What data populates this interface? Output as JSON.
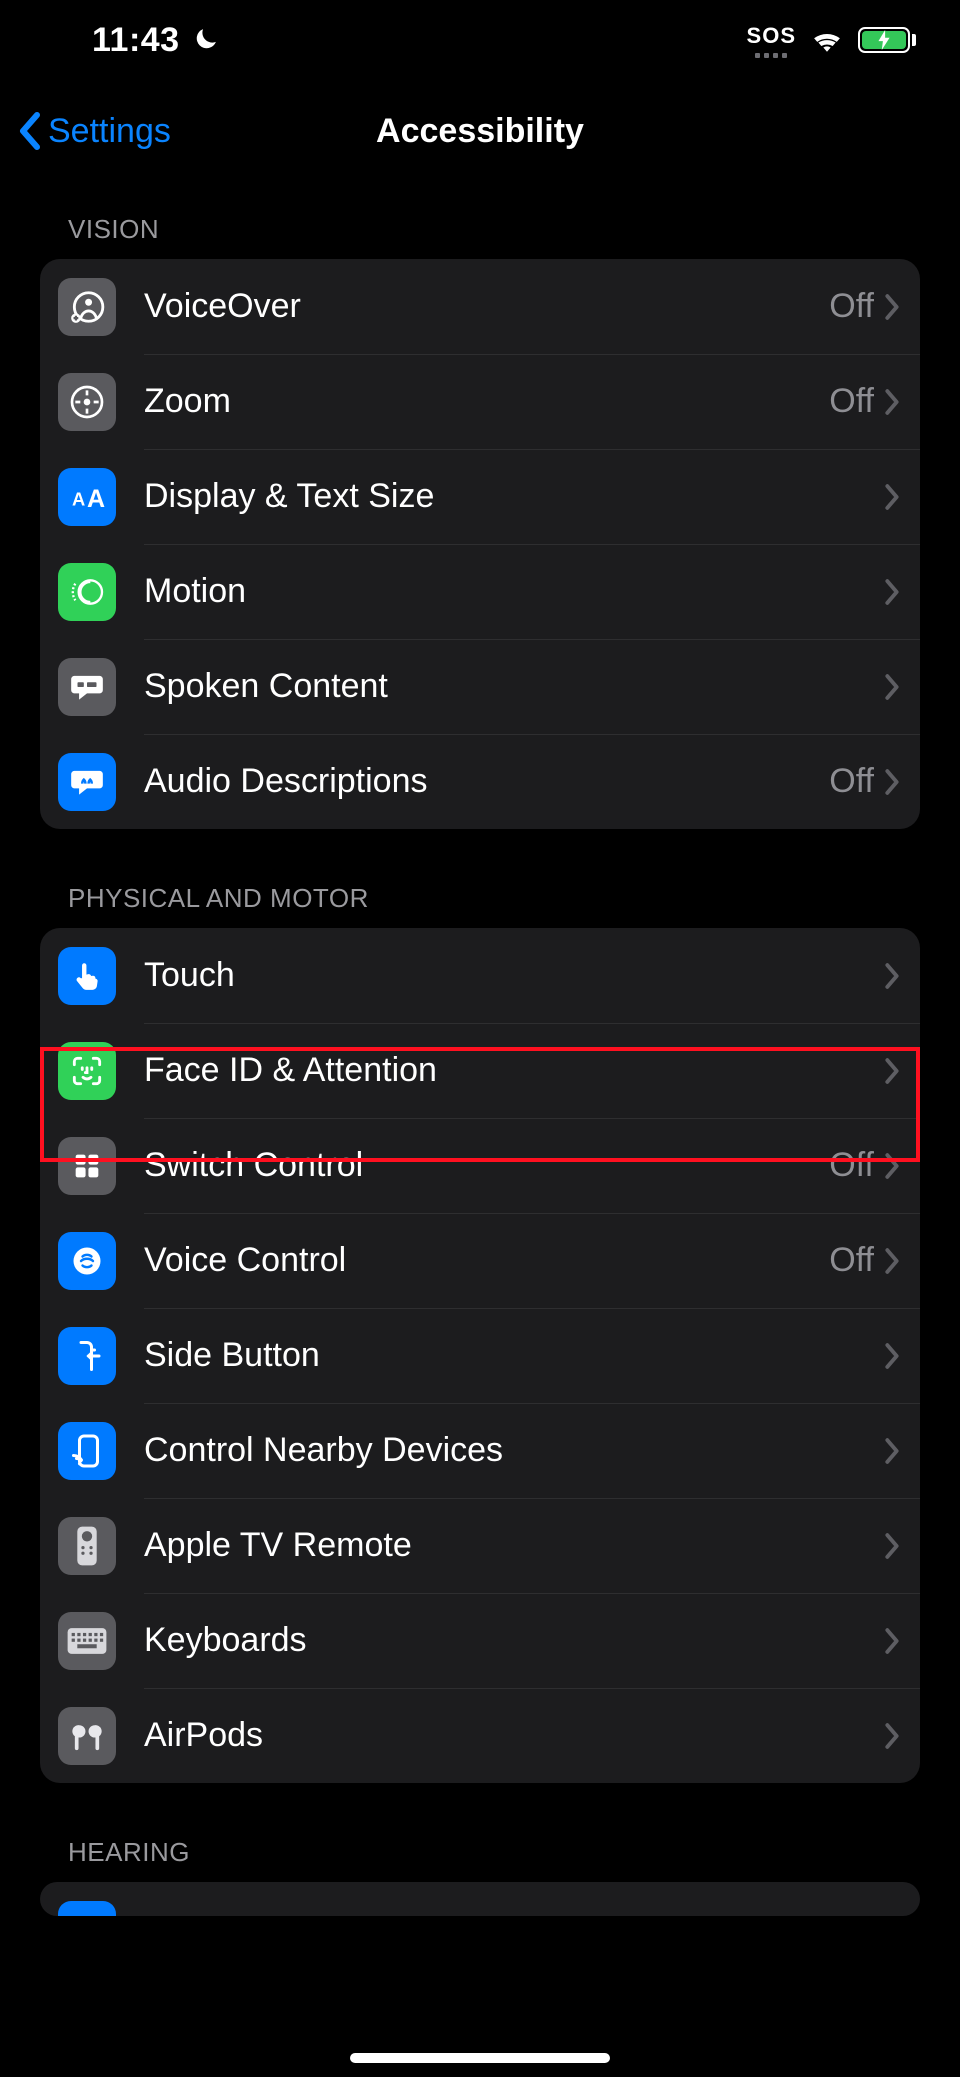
{
  "status": {
    "time": "11:43",
    "moon": "☾",
    "sos": "SOS"
  },
  "nav": {
    "back": "Settings",
    "title": "Accessibility"
  },
  "sections": {
    "vision_header": "VISION",
    "physical_header": "PHYSICAL AND MOTOR",
    "hearing_header": "HEARING"
  },
  "vision": {
    "voiceover": {
      "label": "VoiceOver",
      "value": "Off"
    },
    "zoom": {
      "label": "Zoom",
      "value": "Off"
    },
    "display": {
      "label": "Display & Text Size",
      "value": ""
    },
    "motion": {
      "label": "Motion",
      "value": ""
    },
    "spoken": {
      "label": "Spoken Content",
      "value": ""
    },
    "audiodesc": {
      "label": "Audio Descriptions",
      "value": "Off"
    }
  },
  "physical": {
    "touch": {
      "label": "Touch",
      "value": ""
    },
    "faceid": {
      "label": "Face ID & Attention",
      "value": ""
    },
    "switch": {
      "label": "Switch Control",
      "value": "Off"
    },
    "voice": {
      "label": "Voice Control",
      "value": "Off"
    },
    "sidebtn": {
      "label": "Side Button",
      "value": ""
    },
    "nearby": {
      "label": "Control Nearby Devices",
      "value": ""
    },
    "appletv": {
      "label": "Apple TV Remote",
      "value": ""
    },
    "keyboards": {
      "label": "Keyboards",
      "value": ""
    },
    "airpods": {
      "label": "AirPods",
      "value": ""
    }
  },
  "highlight": {
    "target": "row-touch"
  }
}
